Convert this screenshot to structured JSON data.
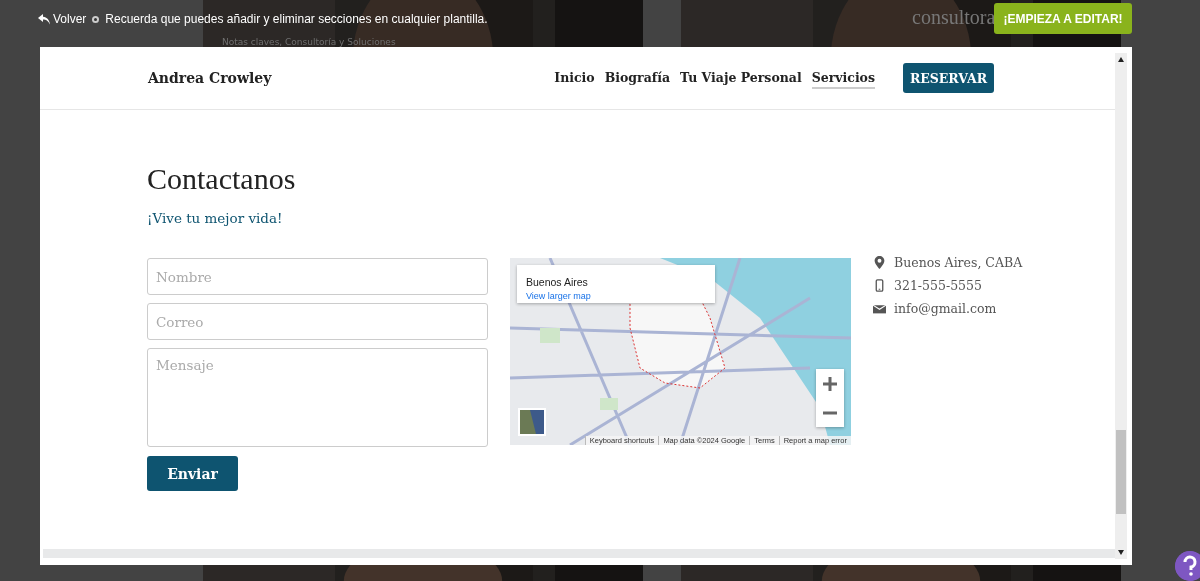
{
  "editor_bar": {
    "back": "Volver",
    "tip": "Recuerda que puedes añadir y eliminar secciones en cualquier plantilla.",
    "cta": "¡EMPIEZA A EDITAR!"
  },
  "background": {
    "subtitle": "Notas claves, Consultoría y Soluciones",
    "heading_fragment": "consultora"
  },
  "preview": {
    "header": {
      "brand": "Andrea Crowley",
      "nav": [
        {
          "label": "Inicio",
          "selected": false
        },
        {
          "label": "Biografía",
          "selected": false
        },
        {
          "label": "Tu Viaje Personal",
          "selected": false
        },
        {
          "label": "Servicios",
          "selected": true
        }
      ],
      "button": "RESERVAR"
    },
    "contact": {
      "title": "Contactanos",
      "subtitle": "¡Vive tu mejor vida!",
      "fields": [
        {
          "kind": "input",
          "placeholder": "Nombre"
        },
        {
          "kind": "input",
          "placeholder": "Correo"
        },
        {
          "kind": "textarea",
          "placeholder": "Mensaje"
        }
      ],
      "submit": "Enviar",
      "map": {
        "kind": "picture",
        "place": "Buenos Aires",
        "link": "View larger map",
        "footer": [
          "Keyboard shortcuts",
          "Map data ©2024 Google",
          "Terms",
          "Report a map error"
        ]
      },
      "details": [
        {
          "kind": "location",
          "text": "Buenos Aires, CABA"
        },
        {
          "kind": "phone",
          "text": "321-555-5555"
        },
        {
          "kind": "email",
          "text": "info@gmail.com"
        }
      ]
    }
  }
}
